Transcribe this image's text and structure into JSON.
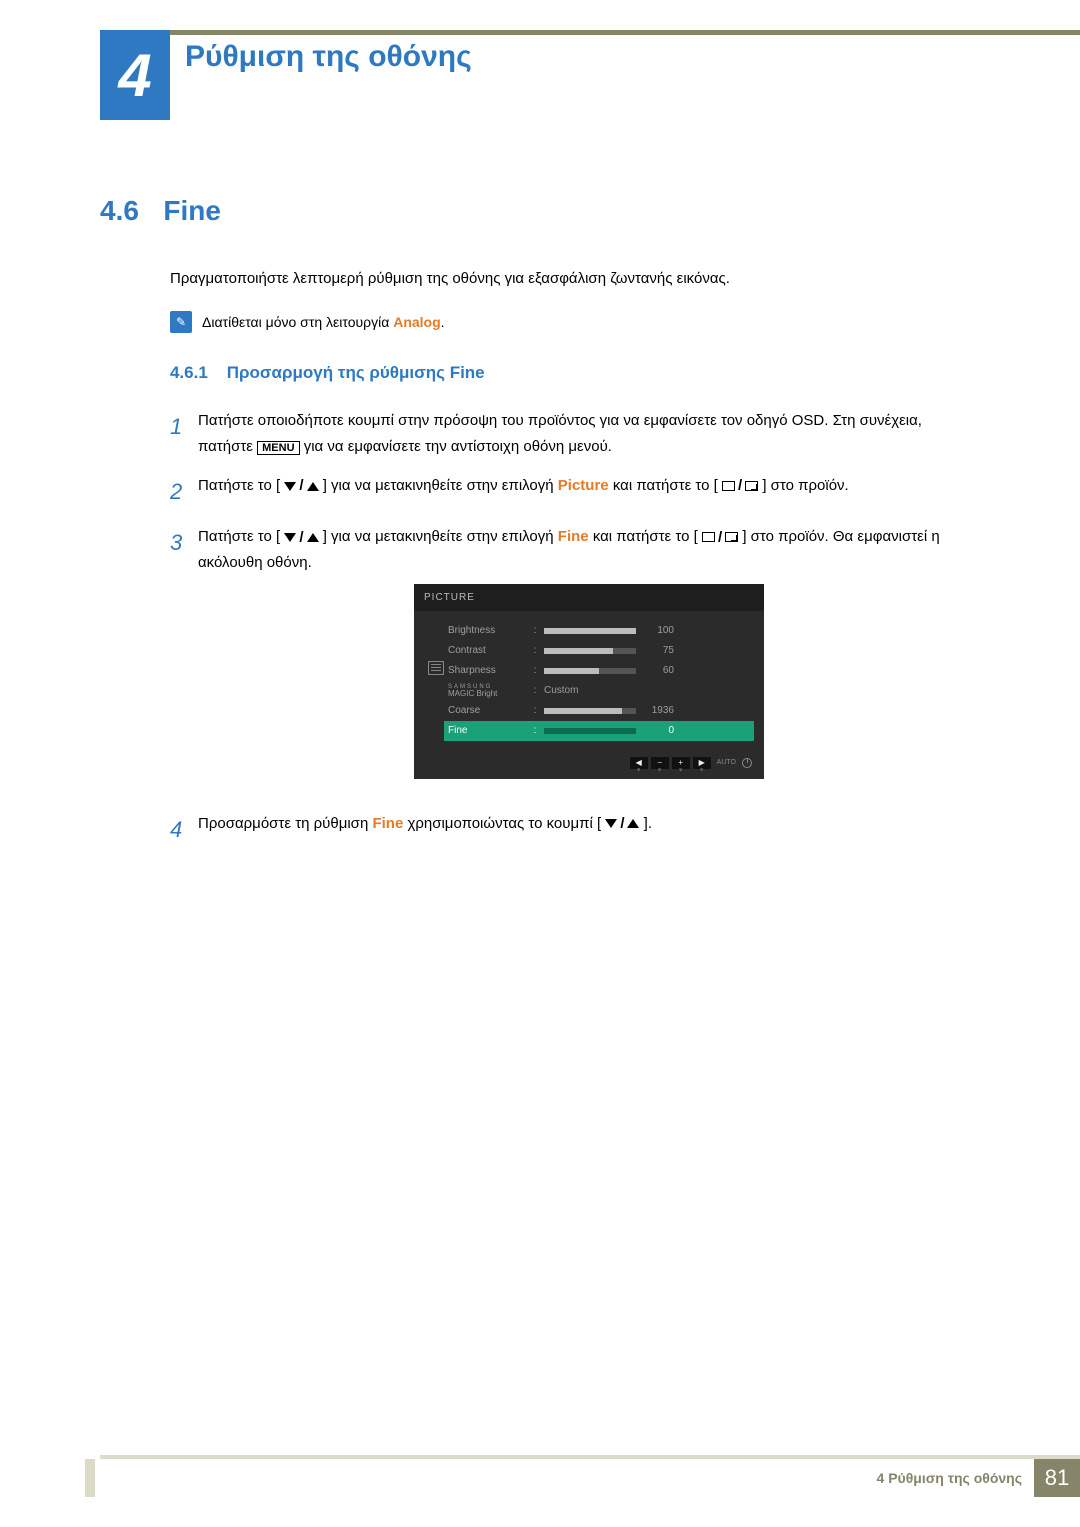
{
  "chapter": {
    "number": "4",
    "title": "Ρύθμιση της οθόνης"
  },
  "section": {
    "number": "4.6",
    "title": "Fine"
  },
  "intro": "Πραγματοποιήστε λεπτομερή ρύθμιση της οθόνης για εξασφάλιση ζωντανής εικόνας.",
  "note": {
    "prefix": "Διατίθεται μόνο στη λειτουργία ",
    "mode": "Analog",
    "suffix": "."
  },
  "subsection": {
    "number": "4.6.1",
    "title": "Προσαρμογή της ρύθμισης Fine"
  },
  "steps": {
    "s1a": "Πατήστε οποιοδήποτε κουμπί στην πρόσοψη του προϊόντος για να εμφανίσετε τον οδηγό OSD. Στη συνέχεια, πατήστε ",
    "s1b": " για να εμφανίσετε την αντίστοιχη οθόνη μενού.",
    "menu_key": "MENU",
    "s2a": "Πατήστε το [",
    "s2b": "] για να μετακινηθείτε στην επιλογή ",
    "s2_picture": "Picture",
    "s2c": " και πατήστε το [",
    "s2d": "] στο προϊόν.",
    "s3a": "Πατήστε το [",
    "s3b": "] για να μετακινηθείτε στην επιλογή ",
    "s3_fine": "Fine",
    "s3c": " και πατήστε το [",
    "s3d": "] στο προϊόν. Θα εμφανιστεί η ακόλουθη οθόνη.",
    "s4a": "Προσαρμόστε τη ρύθμιση ",
    "s4_fine": "Fine",
    "s4b": " χρησιμοποιώντας το κουμπί [",
    "s4c": "]."
  },
  "osd": {
    "title": "PICTURE",
    "rows": {
      "brightness": {
        "label": "Brightness",
        "value": "100",
        "fill": 100
      },
      "contrast": {
        "label": "Contrast",
        "value": "75",
        "fill": 75
      },
      "sharpness": {
        "label": "Sharpness",
        "value": "60",
        "fill": 60
      },
      "magic": {
        "label_top": "SAMSUNG",
        "label_bot": "MAGIC",
        "label_right": "Bright",
        "value": "Custom"
      },
      "coarse": {
        "label": "Coarse",
        "value": "1936",
        "fill": 85
      },
      "fine": {
        "label": "Fine",
        "value": "0",
        "fill": 0
      }
    },
    "footer": {
      "auto": "AUTO"
    }
  },
  "footer": {
    "text": "4 Ρύθμιση της οθόνης",
    "page": "81"
  }
}
